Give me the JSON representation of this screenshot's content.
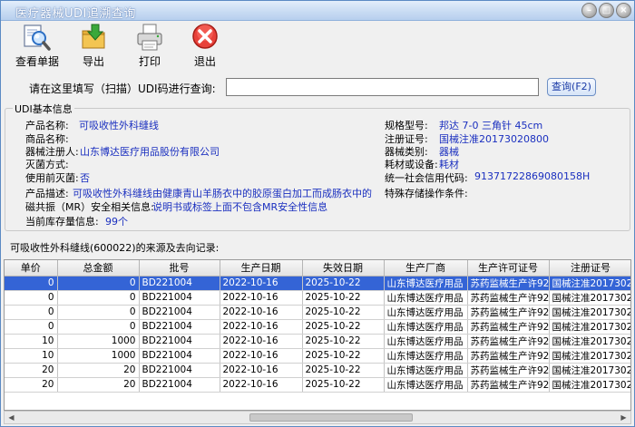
{
  "window": {
    "title": "医疗器械UDI追溯查询"
  },
  "toolbar": [
    {
      "label": "查看单据",
      "icon": "view-document-icon"
    },
    {
      "label": "导出",
      "icon": "export-icon"
    },
    {
      "label": "打印",
      "icon": "printer-icon"
    },
    {
      "label": "退出",
      "icon": "exit-icon"
    }
  ],
  "query": {
    "label": "请在这里填写（扫描）UDI码进行查询:",
    "value": "",
    "button": "查询(F2)"
  },
  "udi": {
    "legend": "UDI基本信息",
    "left": [
      {
        "label": "产品名称:",
        "value": "可吸收性外科缝线"
      },
      {
        "label": "商品名称:",
        "value": ""
      },
      {
        "label": "器械注册人:",
        "value": "山东博达医疗用品股份有限公司"
      },
      {
        "label": "灭菌方式:",
        "value": ""
      },
      {
        "label": "使用前灭菌:",
        "value": "否"
      },
      {
        "label": "产品描述:",
        "value": "可吸收性外科缝线由健康青山羊肠衣中的胶原蛋白加工而成肠衣中的"
      },
      {
        "label": "磁共振（MR）安全相关信息:",
        "value": "说明书或标签上面不包含MR安全性信息"
      },
      {
        "label": "当前库存量信息:",
        "value": "99个"
      }
    ],
    "right": [
      {
        "label": "规格型号:",
        "value": "邦达 7-0 三角针 45cm"
      },
      {
        "label": "注册证号:",
        "value": "国械注准20173020800"
      },
      {
        "label": "器械类别:",
        "value": "器械"
      },
      {
        "label": "耗材或设备:",
        "value": "耗材"
      },
      {
        "label": "统一社会信用代码:",
        "value": "91371722869080158H"
      },
      {
        "label": "特殊存储操作条件:",
        "value": ""
      }
    ]
  },
  "records": {
    "title": "可吸收性外科缝线(600022)的来源及去向记录:",
    "columns": [
      "单价",
      "总金额",
      "批号",
      "生产日期",
      "失效日期",
      "生产厂商",
      "生产许可证号",
      "注册证号"
    ],
    "rows": [
      [
        "0",
        "0",
        "BD221004",
        "2022-10-16",
        "2025-10-22",
        "山东博达医疗用品",
        "苏药监械生产许92",
        "国械注准2017302"
      ],
      [
        "0",
        "0",
        "BD221004",
        "2022-10-16",
        "2025-10-22",
        "山东博达医疗用品",
        "苏药监械生产许92",
        "国械注准2017302"
      ],
      [
        "0",
        "0",
        "BD221004",
        "2022-10-16",
        "2025-10-22",
        "山东博达医疗用品",
        "苏药监械生产许92",
        "国械注准2017302"
      ],
      [
        "0",
        "0",
        "BD221004",
        "2022-10-16",
        "2025-10-22",
        "山东博达医疗用品",
        "苏药监械生产许92",
        "国械注准2017302"
      ],
      [
        "10",
        "1000",
        "BD221004",
        "2022-10-16",
        "2025-10-22",
        "山东博达医疗用品",
        "苏药监械生产许92",
        "国械注准2017302"
      ],
      [
        "10",
        "1000",
        "BD221004",
        "2022-10-16",
        "2025-10-22",
        "山东博达医疗用品",
        "苏药监械生产许92",
        "国械注准2017302"
      ],
      [
        "20",
        "20",
        "BD221004",
        "2022-10-16",
        "2025-10-22",
        "山东博达医疗用品",
        "苏药监械生产许92",
        "国械注准2017302"
      ],
      [
        "20",
        "20",
        "BD221004",
        "2022-10-16",
        "2025-10-22",
        "山东博达医疗用品",
        "苏药监械生产许92",
        "国械注准2017302"
      ]
    ]
  },
  "colors": {
    "accent": "#1a2fbf",
    "selected_row": "#3464d6"
  }
}
